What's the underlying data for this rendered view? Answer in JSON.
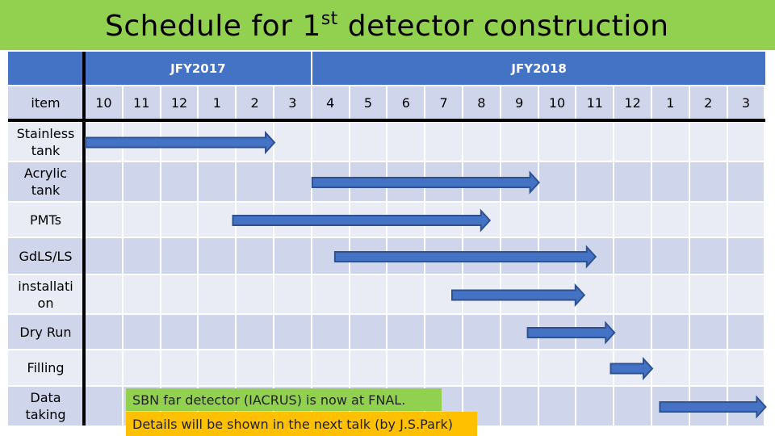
{
  "title": {
    "prefix": "Schedule for 1",
    "superscript": "st",
    "suffix": " detector construction"
  },
  "colors": {
    "title_bg": "#92d050",
    "header_bg": "#4472c4",
    "band_light": "#e9ebf5",
    "band_dark": "#cfd5ea",
    "arrow_fill": "#4472c4",
    "arrow_stroke": "#2f528f",
    "note_green": "#92d050",
    "note_orange": "#ffc000"
  },
  "chart_data": {
    "type": "gantt",
    "title": "Schedule for 1st detector construction",
    "item_header": "item",
    "fiscal_years": [
      {
        "label": "JFY2017",
        "months": 6
      },
      {
        "label": "JFY2018",
        "months": 12
      }
    ],
    "months": [
      "10",
      "11",
      "12",
      "1",
      "2",
      "3",
      "4",
      "5",
      "6",
      "7",
      "8",
      "9",
      "10",
      "11",
      "12",
      "1",
      "2",
      "3"
    ],
    "tasks": [
      {
        "name": "Stainless tank",
        "lines": [
          "Stainless",
          "tank"
        ],
        "start": 0.0,
        "end": 5.0
      },
      {
        "name": "Acrylic tank",
        "lines": [
          "Acrylic",
          "tank"
        ],
        "start": 6.0,
        "end": 12.0
      },
      {
        "name": "PMTs",
        "lines": [
          "PMTs"
        ],
        "start": 3.9,
        "end": 10.7
      },
      {
        "name": "GdLS/LS",
        "lines": [
          "GdLS/LS"
        ],
        "start": 6.6,
        "end": 13.5
      },
      {
        "name": "installation",
        "lines": [
          "installati",
          "on"
        ],
        "start": 9.7,
        "end": 13.2
      },
      {
        "name": "Dry Run",
        "lines": [
          "Dry Run"
        ],
        "start": 11.7,
        "end": 14.0
      },
      {
        "name": "Filling",
        "lines": [
          "Filling"
        ],
        "start": 13.9,
        "end": 15.0
      },
      {
        "name": "Data taking",
        "lines": [
          "Data",
          "taking"
        ],
        "start": 15.2,
        "end": 18.0
      }
    ],
    "time_unit": "month index from Oct 2017 (0 = start of Oct 2017, 18 = end of Mar 2019)"
  },
  "notes": {
    "green": "SBN far detector (IACRUS) is now at FNAL.",
    "orange": "Details will be shown in the next talk (by J.S.Park)"
  }
}
